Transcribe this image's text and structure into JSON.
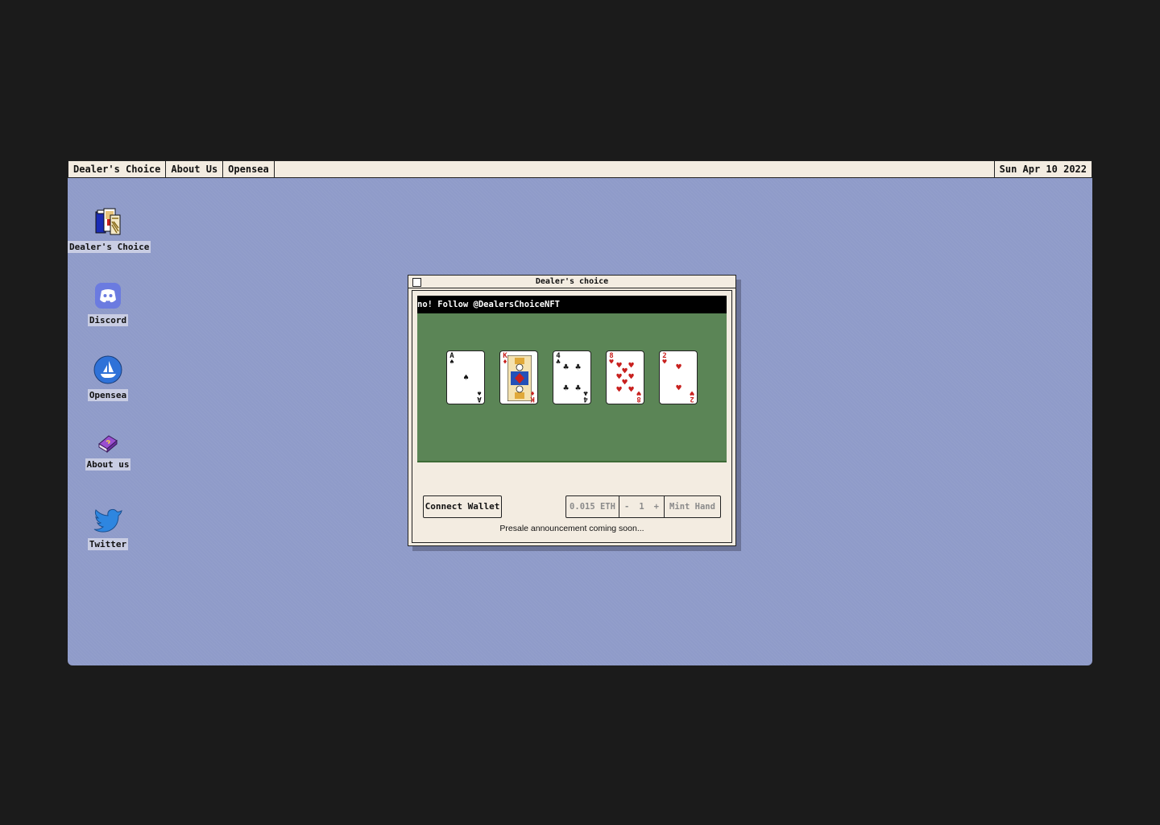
{
  "menubar": {
    "items": [
      {
        "label": "Dealer's Choice"
      },
      {
        "label": "About Us"
      },
      {
        "label": "Opensea"
      }
    ],
    "date": "Sun Apr 10 2022"
  },
  "desktop_icons": [
    {
      "label": "Dealer's Choice",
      "icon": "cards-icon"
    },
    {
      "label": "Discord",
      "icon": "discord-icon"
    },
    {
      "label": "Opensea",
      "icon": "opensea-icon"
    },
    {
      "label": "About us",
      "icon": "book-icon"
    },
    {
      "label": "Twitter",
      "icon": "twitter-icon"
    }
  ],
  "window": {
    "title": "Dealer's choice",
    "ticker": "no! Follow @DealersChoiceNFT",
    "cards": [
      {
        "rank": "A",
        "suit": "♠",
        "color": "#111111"
      },
      {
        "rank": "K",
        "suit": "♦",
        "color": "#c8201e"
      },
      {
        "rank": "4",
        "suit": "♣",
        "color": "#111111"
      },
      {
        "rank": "8",
        "suit": "♥",
        "color": "#c8201e"
      },
      {
        "rank": "2",
        "suit": "♥",
        "color": "#c8201e"
      }
    ],
    "connect_label": "Connect Wallet",
    "price": "0.015 ETH",
    "minus": "-",
    "quantity": "1",
    "plus": "+",
    "mint_label": "Mint Hand",
    "presale_text": "Presale announcement coming soon..."
  },
  "colors": {
    "desktop": "#8f9bc9",
    "table": "#5b8556",
    "window": "#f3ece1"
  }
}
